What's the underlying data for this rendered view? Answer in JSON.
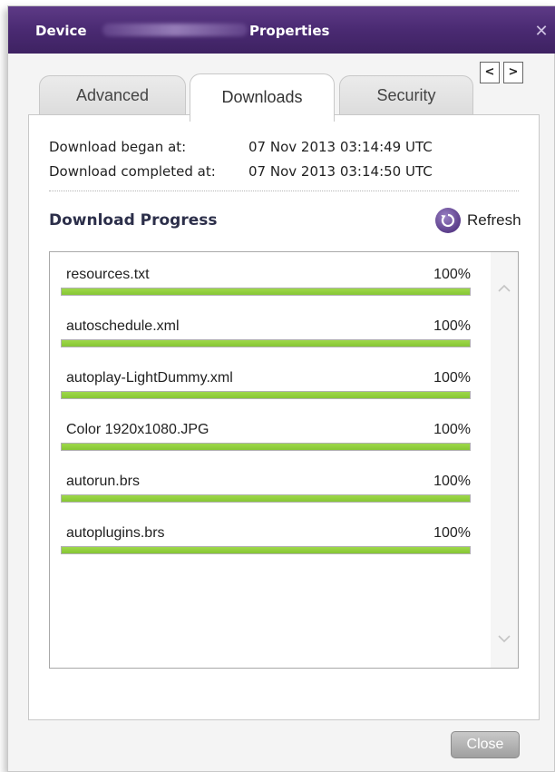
{
  "window": {
    "title_prefix": "Device",
    "title_suffix": "Properties",
    "close_symbol": "✕"
  },
  "tabs": [
    {
      "label": "Advanced",
      "active": false
    },
    {
      "label": "Downloads",
      "active": true
    },
    {
      "label": "Security",
      "active": false
    }
  ],
  "tab_nav": {
    "prev": "<",
    "next": ">"
  },
  "info": {
    "began_label": "Download began at:",
    "began_value": "07 Nov 2013 03:14:49 UTC",
    "completed_label": "Download completed at:",
    "completed_value": "07 Nov 2013 03:14:50 UTC"
  },
  "progress_section": {
    "title": "Download Progress",
    "refresh_label": "Refresh",
    "refresh_icon": "refresh-icon"
  },
  "downloads": [
    {
      "name": "resources.txt",
      "percent_text": "100%",
      "progress": 1.0
    },
    {
      "name": "autoschedule.xml",
      "percent_text": "100%",
      "progress": 1.0
    },
    {
      "name": "autoplay-LightDummy.xml",
      "percent_text": "100%",
      "progress": 1.0
    },
    {
      "name": "Color 1920x1080.JPG",
      "percent_text": "100%",
      "progress": 1.0
    },
    {
      "name": "autorun.brs",
      "percent_text": "100%",
      "progress": 1.0
    },
    {
      "name": "autoplugins.brs",
      "percent_text": "100%",
      "progress": 1.0
    }
  ],
  "buttons": {
    "close_label": "Close"
  },
  "colors": {
    "titlebar": "#4a2a72",
    "progress_fill": "#8fcd3a",
    "section_title": "#2c2f4a"
  }
}
